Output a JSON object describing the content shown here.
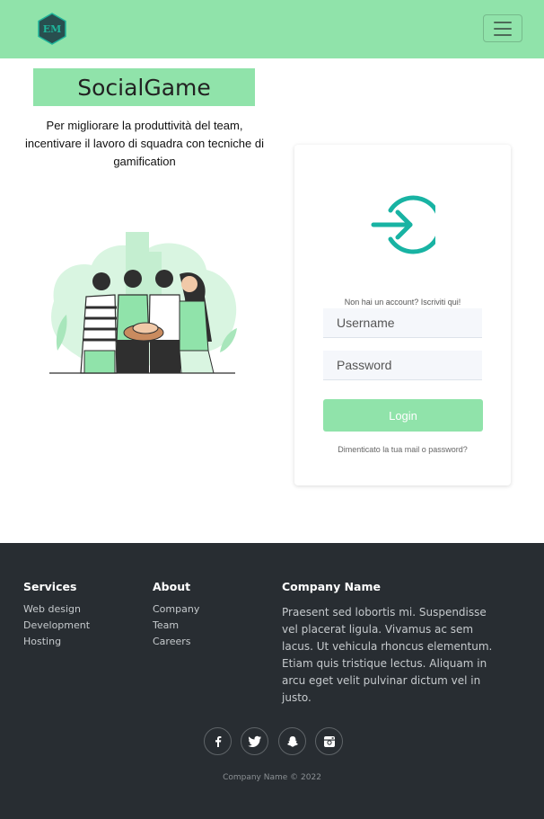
{
  "navbar": {
    "logo_text": "EM",
    "colors": {
      "bg": "#90e3aa",
      "logo_fill": "#284f4f",
      "logo_accent": "#1fb49a"
    },
    "menu_icon": "hamburger-menu-icon"
  },
  "hero": {
    "title": "SocialGame",
    "tagline": "Per migliorare la produttività del team, incentivare il lavoro di squadra con tecniche di gamification",
    "illustration": "team-hands-together-illustration"
  },
  "login": {
    "icon": "login-arrow-icon",
    "signup_link": "Non hai un account? Iscriviti qui!",
    "username_placeholder": "Username",
    "password_placeholder": "Password",
    "login_label": "Login",
    "forgot_link": "Dimenticato la tua mail o password?",
    "colors": {
      "accent": "#18b3a3",
      "button": "#90e3aa"
    }
  },
  "footer": {
    "services": {
      "title": "Services",
      "items": [
        "Web design",
        "Development",
        "Hosting"
      ]
    },
    "about": {
      "title": "About",
      "items": [
        "Company",
        "Team",
        "Careers"
      ]
    },
    "company": {
      "title": "Company Name",
      "description": "Praesent sed lobortis mi. Suspendisse vel placerat ligula. Vivamus ac sem lacus. Ut vehicula rhoncus elementum. Etiam quis tristique lectus. Aliquam in arcu eget velit pulvinar dictum vel in justo."
    },
    "social": [
      "facebook-icon",
      "twitter-icon",
      "snapchat-icon",
      "instagram-icon"
    ],
    "copyright": "Company Name © 2022",
    "colors": {
      "bg": "#282d32"
    }
  }
}
